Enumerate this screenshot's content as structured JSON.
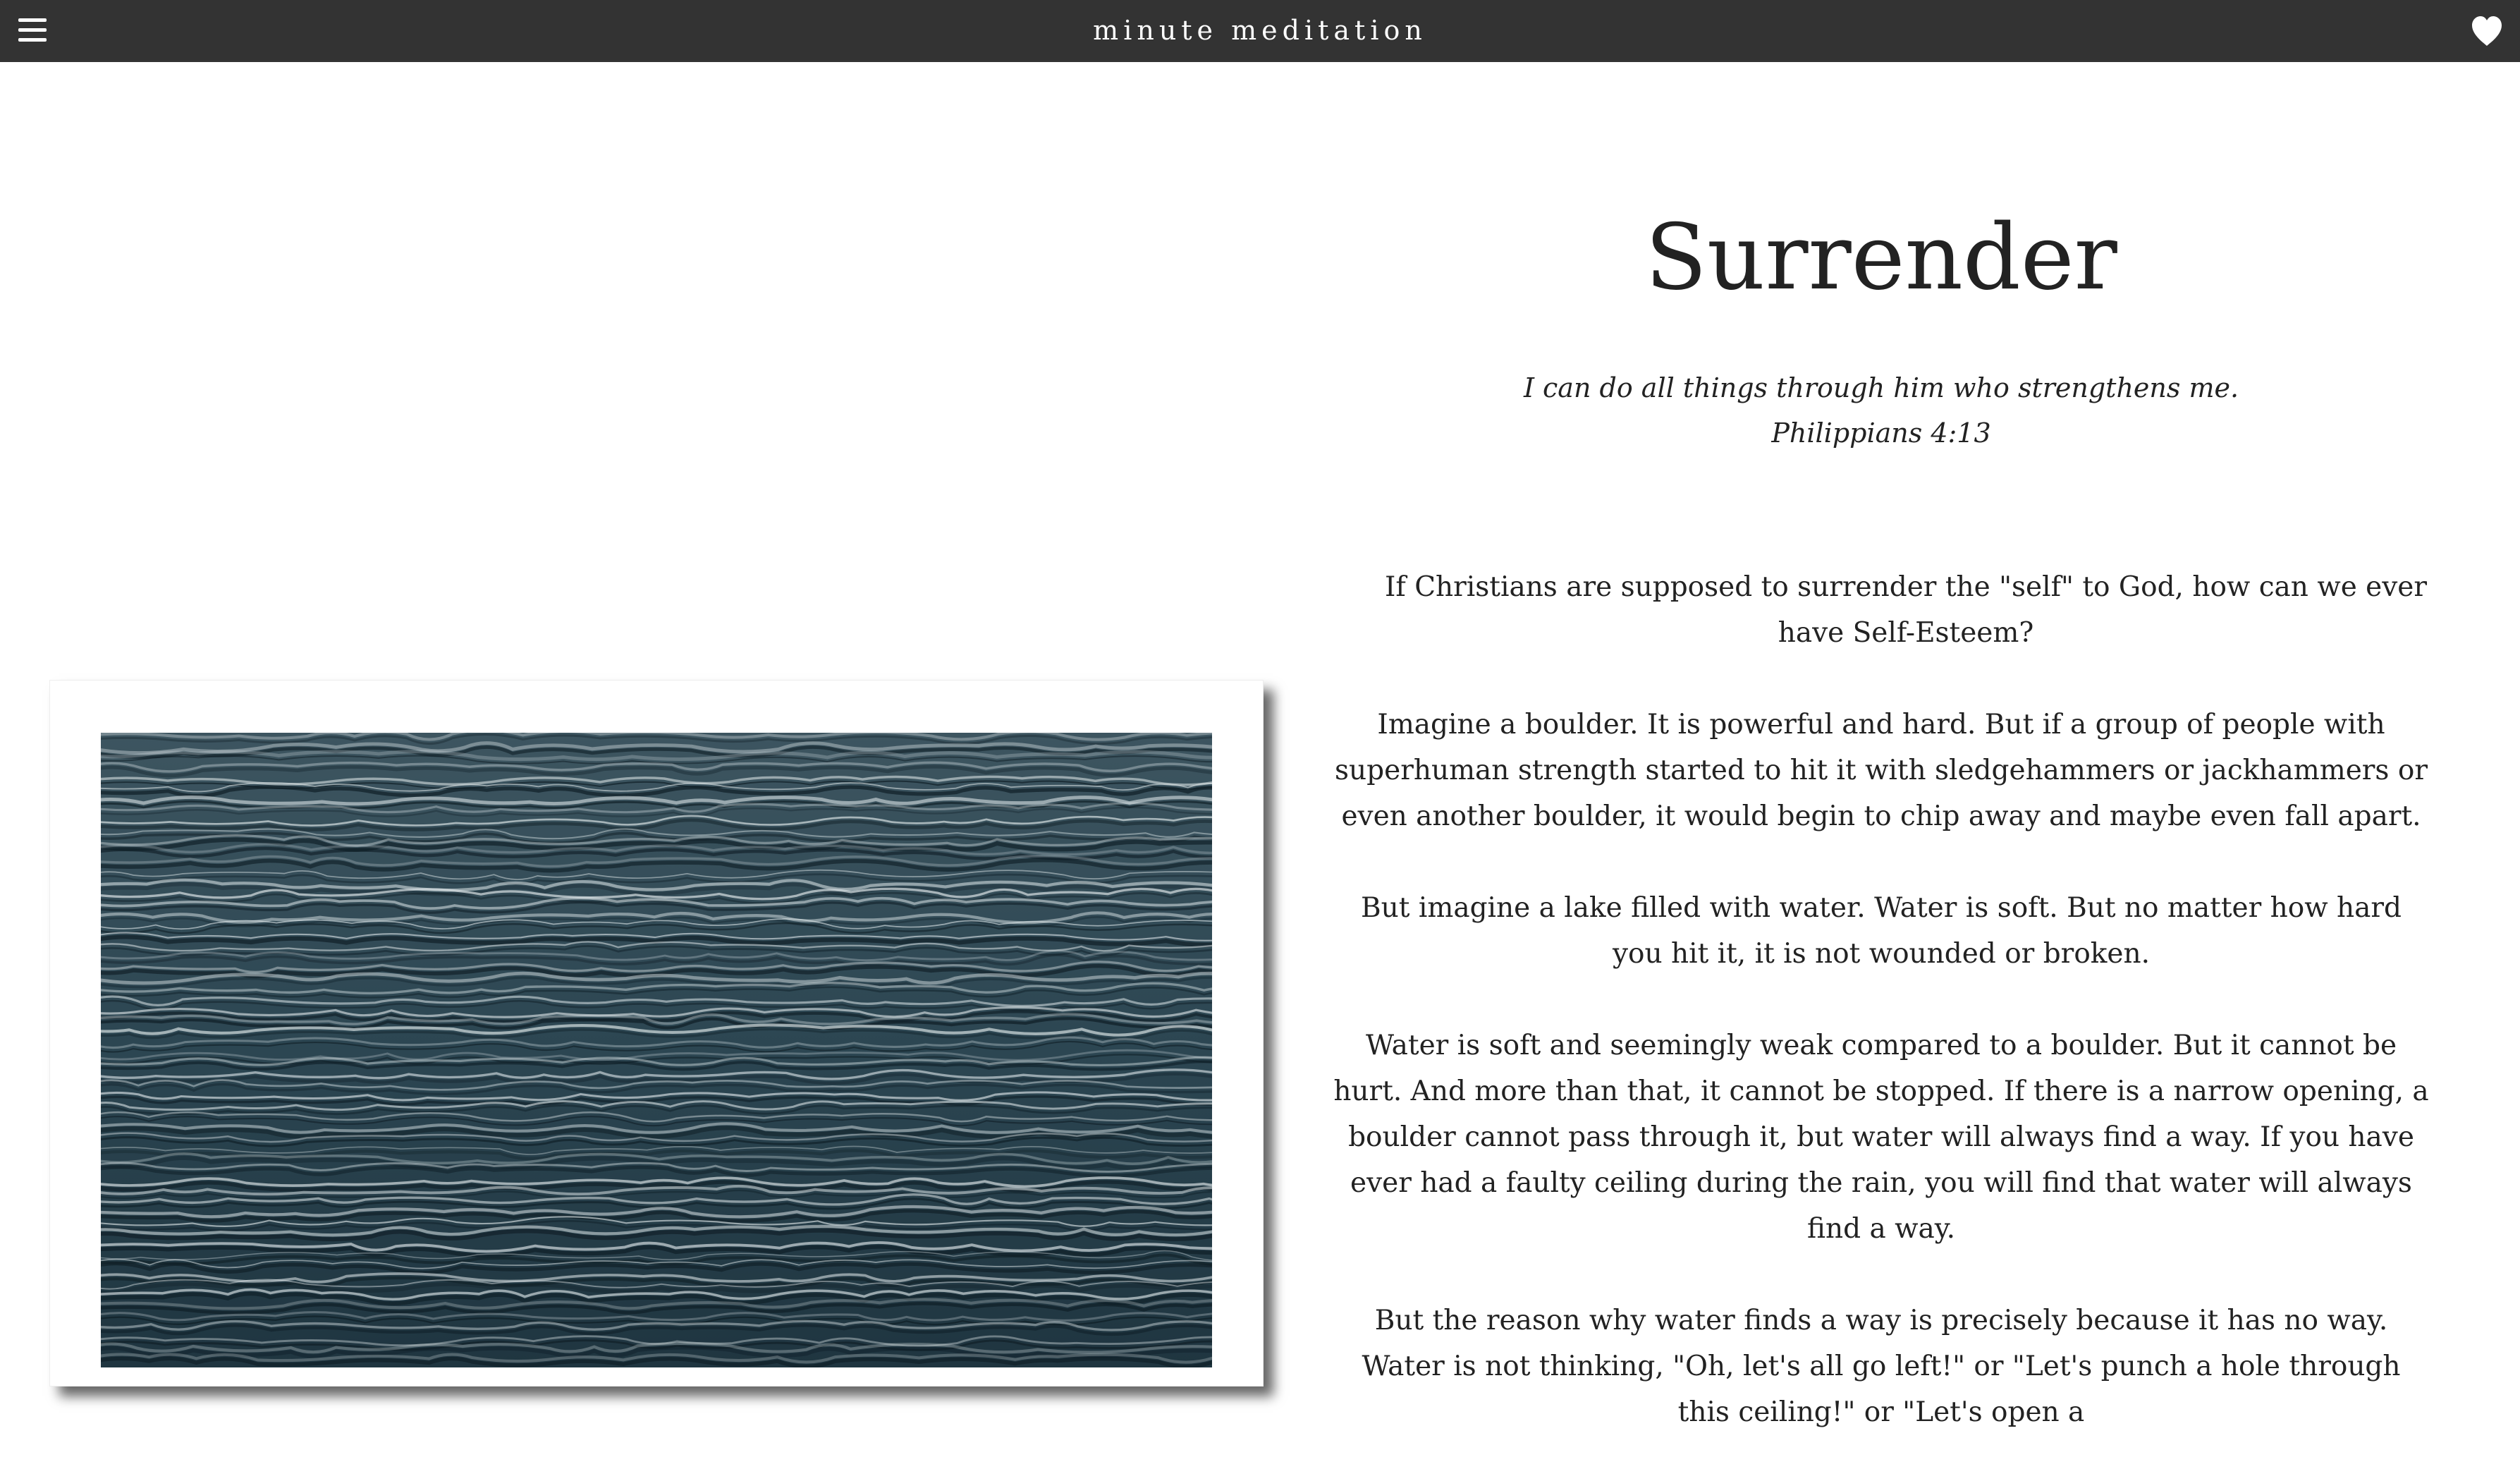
{
  "header": {
    "menu_icon": "hamburger-menu-icon",
    "brand": "minute meditation",
    "favorite_icon": "heart-icon"
  },
  "colors": {
    "header_bg": "#333333",
    "header_text": "#ffffff",
    "body_text": "#222222",
    "page_bg": "#ffffff"
  },
  "article": {
    "title": "Surrender",
    "verse_text": "I can do all things through him who strengthens me.",
    "verse_ref": "Philippians 4:13",
    "paragraphs": [
      "If Christians are supposed to surrender the \"self\" to God, how can we ever have Self-Esteem?",
      "Imagine a boulder. It is powerful and hard. But if a group of people with superhuman strength started to hit it with sledgehammers or jackhammers or even another boulder, it would begin to chip away and maybe even fall apart.",
      "But imagine a lake filled with water. Water is soft. But no matter how hard you hit it, it is not wounded or broken.",
      "Water is soft and seemingly weak compared to a boulder. But it cannot be hurt. And more than that, it cannot be stopped. If there is a narrow opening, a boulder cannot pass through it, but water will always find a way. If you have ever had a faulty ceiling during the rain, you will find that water will always find a way.",
      "But the reason why water finds a way is precisely because it has no way. Water is not thinking, \"Oh, let's all go left!\" or \"Let's punch a hole through this ceiling!\" or \"Let's open a"
    ]
  },
  "image": {
    "subject": "rippling dark water surface"
  }
}
